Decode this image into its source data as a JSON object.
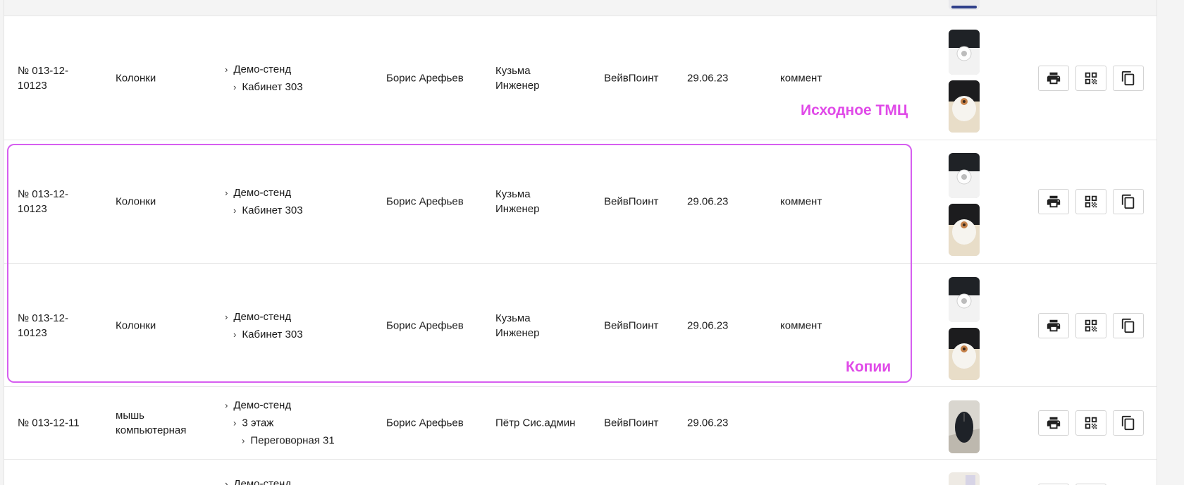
{
  "rows": [
    {
      "id": "№ 013-12-10123",
      "name": "Колонки",
      "location": [
        "Демо-стенд",
        "Кабинет 303"
      ],
      "responsible": "Борис Арефьев",
      "user": "Кузьма Инженер",
      "organization": "ВейвПоинт",
      "date": "29.06.23",
      "comment": "коммент"
    },
    {
      "id": "№ 013-12-10123",
      "name": "Колонки",
      "location": [
        "Демо-стенд",
        "Кабинет 303"
      ],
      "responsible": "Борис Арефьев",
      "user": "Кузьма Инженер",
      "organization": "ВейвПоинт",
      "date": "29.06.23",
      "comment": "коммент"
    },
    {
      "id": "№ 013-12-10123",
      "name": "Колонки",
      "location": [
        "Демо-стенд",
        "Кабинет 303"
      ],
      "responsible": "Борис Арефьев",
      "user": "Кузьма Инженер",
      "organization": "ВейвПоинт",
      "date": "29.06.23",
      "comment": "коммент"
    },
    {
      "id": "№ 013-12-11",
      "name": "мышь компьютерная",
      "location": [
        "Демо-стенд",
        "3 этаж",
        "Переговорная 31"
      ],
      "responsible": "Борис Арефьев",
      "user": "Пётр Сис.админ",
      "organization": "ВейвПоинт",
      "date": "29.06.23",
      "comment": ""
    }
  ],
  "partial_bottom_row": {
    "location_first": "Демо-стенд"
  },
  "annotations": {
    "original_label": "Исходное ТМЦ",
    "copies_label": "Копии",
    "color": "#e04ae8"
  },
  "actions": {
    "print_icon": "print-icon",
    "qr_icon": "qr-code-icon",
    "copy_icon": "copy-icon"
  }
}
